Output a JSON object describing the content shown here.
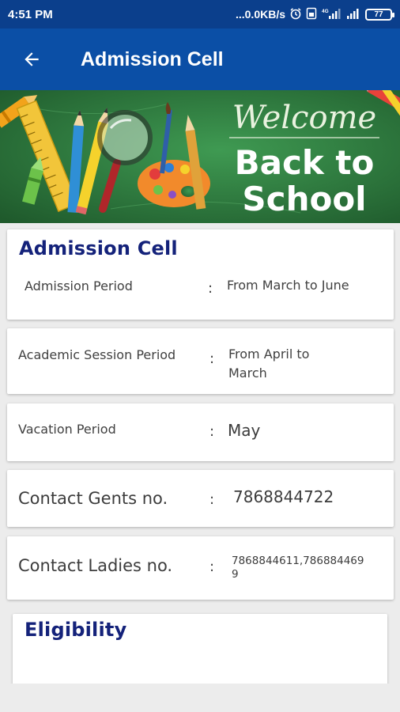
{
  "status_bar": {
    "time": "4:51 PM",
    "network_speed": "...0.0KB/s",
    "alarm_icon": "alarm-clock-icon",
    "signal_badge": "4G",
    "battery": "77"
  },
  "app_bar": {
    "back_icon": "arrow-left-icon",
    "title": "Admission Cell"
  },
  "banner": {
    "welcome": "Welcome",
    "line1": "Back to",
    "line2": "School"
  },
  "admission_card": {
    "title": "Admission Cell",
    "label": "Admission Period",
    "colon": ":",
    "value": "From March to June"
  },
  "session_card": {
    "label": "Academic Session Period",
    "colon": ":",
    "value": "From April to March"
  },
  "vacation_card": {
    "label": "Vacation Period",
    "colon": ":",
    "value": "May"
  },
  "gents_card": {
    "label": "Contact  Gents no.",
    "colon": ":",
    "value": "7868844722"
  },
  "ladies_card": {
    "label": "Contact  Ladies no.",
    "colon": ":",
    "value": "7868844611,7868844699"
  },
  "eligibility_card": {
    "title": "Eligibility"
  },
  "colors": {
    "status_bar": "#0b3f8c",
    "app_bar": "#0b4fa6",
    "title_navy": "#14227a",
    "chalkboard": "#2f7a3f"
  }
}
